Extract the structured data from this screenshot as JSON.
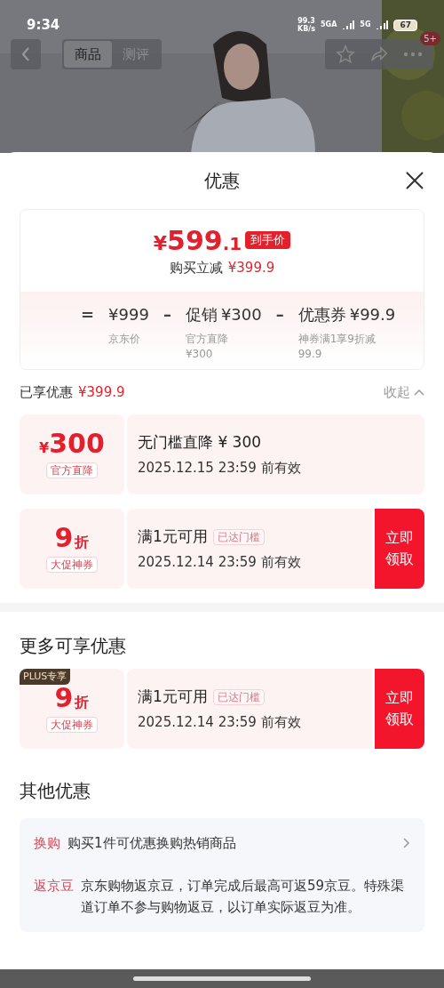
{
  "status_bar": {
    "time": "9:34",
    "speed": "99.3",
    "speed_unit": "KB/s",
    "network_1": "5GA",
    "network_2": "5G",
    "battery": "67"
  },
  "nav": {
    "tabs": [
      {
        "label": "商品",
        "selected": true
      },
      {
        "label": "测评",
        "selected": false
      }
    ],
    "badge": "5+"
  },
  "sheet": {
    "title": "优惠",
    "price_card": {
      "price_symbol": "¥",
      "price_main": "599",
      "price_decimal": ".1",
      "price_tag": "到手价",
      "saving_label": "购买立减",
      "saving_value": "¥399.9",
      "breakdown": [
        {
          "operator": "=",
          "value": "¥999",
          "notes": [
            "京东价"
          ]
        },
        {
          "operator": "–",
          "label": "促销",
          "value": "¥300",
          "notes": [
            "官方直降",
            "¥300"
          ]
        },
        {
          "operator": "–",
          "label": "优惠券",
          "value": "¥99.9",
          "notes": [
            "神券满1享9折减",
            "99.9"
          ]
        }
      ]
    },
    "enjoyed": {
      "label": "已享优惠",
      "value": "¥399.9",
      "toggle": "收起",
      "expanded": true
    },
    "coupons": [
      {
        "kind": "amount",
        "symbol": "¥",
        "amount": "300",
        "tag": "官方直降",
        "title": "无门槛直降 ¥ 300",
        "validity": "2025.12.15 23:59 前有效"
      },
      {
        "kind": "discount",
        "amount": "9",
        "unit": "折",
        "tag": "大促神券",
        "title": "满1元可用",
        "status": "已达门槛",
        "validity": "2025.12.14 23:59 前有效",
        "action": "立即领取"
      }
    ],
    "more": {
      "title": "更多可享优惠",
      "coupons": [
        {
          "kind": "discount",
          "ribbon": "PLUS专享",
          "amount": "9",
          "unit": "折",
          "tag": "大促神券",
          "title": "满1元可用",
          "status": "已达门槛",
          "validity": "2025.12.14 23:59 前有效",
          "action": "立即领取"
        }
      ]
    },
    "other": {
      "title": "其他优惠",
      "items": [
        {
          "label": "换购",
          "text": "购买1件可优惠换购热销商品",
          "has_arrow": true
        },
        {
          "label": "返京豆",
          "text": "京东购物返京豆，订单完成后最高可返59京豆。特殊渠道订单不参与购物返豆，以订单实际返豆为准。"
        }
      ]
    }
  }
}
